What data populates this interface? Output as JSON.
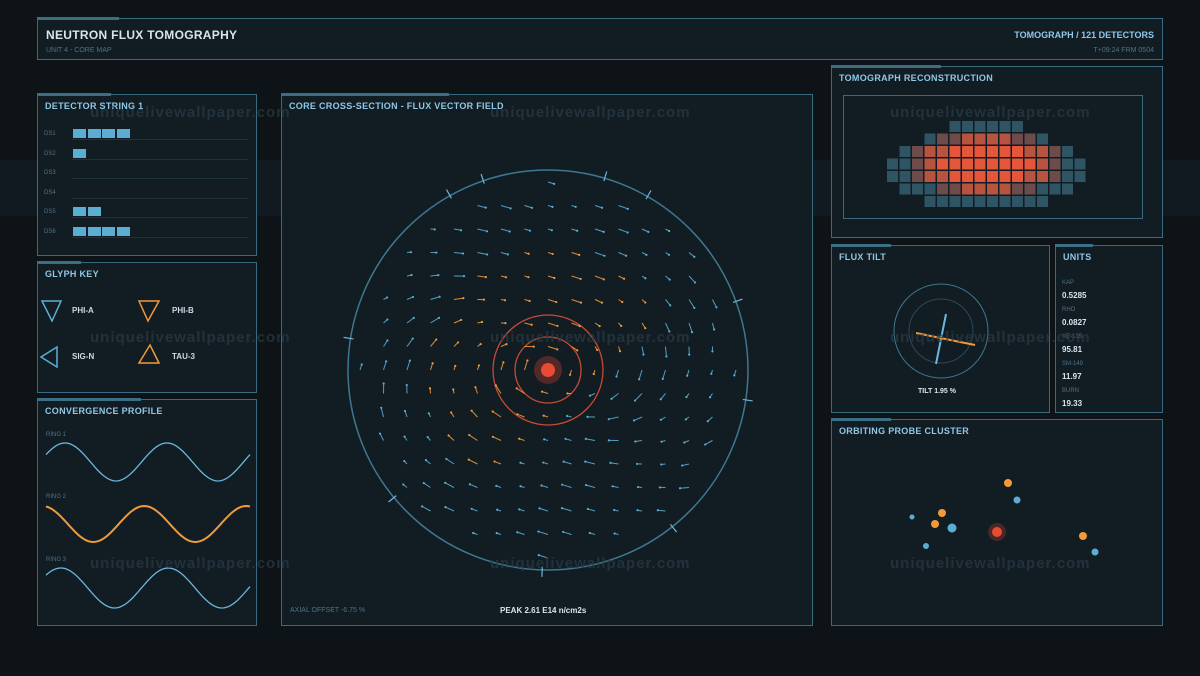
{
  "header": {
    "title": "NEUTRON FLUX TOMOGRAPHY",
    "subtitle": "UNIT 4 - CORE MAP",
    "right_title": "TOMOGRAPH / 121 DETECTORS",
    "right_sub": "T+09:24  FRM 0504"
  },
  "detector": {
    "title": "DETECTOR STRING 1",
    "rows": [
      {
        "label": "DS1",
        "count": 4
      },
      {
        "label": "DS2",
        "count": 1
      },
      {
        "label": "DS3",
        "count": 0
      },
      {
        "label": "DS4",
        "count": 0
      },
      {
        "label": "DS5",
        "count": 2
      },
      {
        "label": "DS6",
        "count": 4
      }
    ],
    "bar_color": "#5aaed4"
  },
  "glyph_key": {
    "title": "GLYPH KEY",
    "items": [
      {
        "label": "PHI-A",
        "color": "#5aaed4",
        "icon": "triangle-down-icon"
      },
      {
        "label": "PHI-B",
        "color": "#f29a3a",
        "icon": "triangle-down-icon"
      },
      {
        "label": "SIG-N",
        "color": "#5aaed4",
        "icon": "triangle-left-icon"
      },
      {
        "label": "TAU-3",
        "color": "#f29a3a",
        "icon": "triangle-up-icon"
      }
    ]
  },
  "convergence": {
    "title": "CONVERGENCE PROFILE",
    "rings": [
      {
        "label": "RING 1",
        "color": "#6ab8dc"
      },
      {
        "label": "RING 2",
        "color": "#f29a3a"
      },
      {
        "label": "RING 3",
        "color": "#6ab8dc"
      }
    ]
  },
  "core": {
    "title": "CORE CROSS-SECTION - FLUX VECTOR FIELD",
    "axial": "AXIAL OFFSET -6.75 %",
    "peak": "PEAK 2.61 E14 n/cm2s",
    "hot_color": "#e84a32",
    "vector_color_a": "#5aaed4",
    "vector_color_b": "#f29a3a"
  },
  "tomograph": {
    "title": "TOMOGRAPH RECONSTRUCTION"
  },
  "flux_tilt": {
    "title": "FLUX TILT",
    "label": "TILT 1.95 %"
  },
  "units": {
    "title": "UNITS",
    "items": [
      {
        "label": "KAP",
        "value": "0.5285"
      },
      {
        "label": "RHO",
        "value": "0.0827"
      },
      {
        "label": "XE-135",
        "value": "95.81"
      },
      {
        "label": "SM-149",
        "value": "11.97"
      },
      {
        "label": "BURN",
        "value": "19.33"
      }
    ]
  },
  "probe": {
    "title": "ORBITING PROBE CLUSTER"
  },
  "watermark": "uniquelivewallpaper.com"
}
